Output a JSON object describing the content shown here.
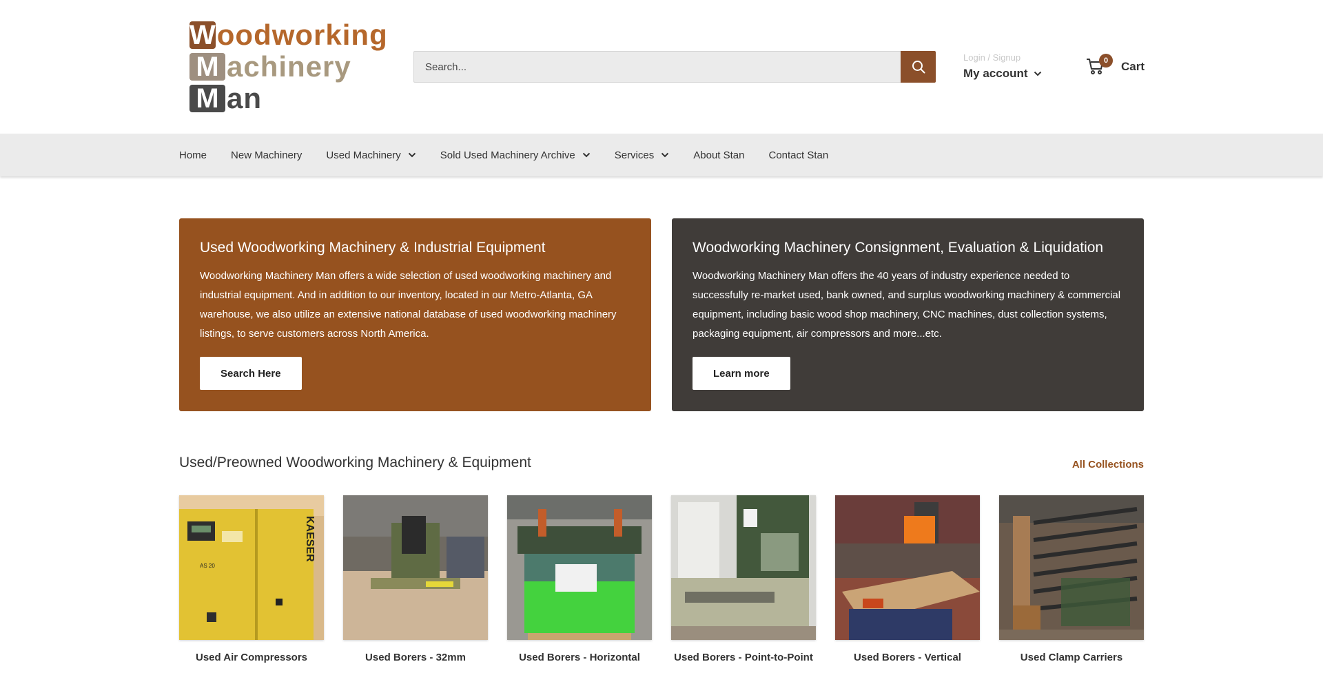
{
  "logo": {
    "rows": [
      {
        "initial": "W",
        "rest": "oodworking"
      },
      {
        "initial": "M",
        "rest": "achinery"
      },
      {
        "initial": "M",
        "rest": "an"
      }
    ]
  },
  "search": {
    "placeholder": "Search..."
  },
  "account": {
    "login_label": "Login / Signup",
    "account_label": "My account"
  },
  "cart": {
    "count": "0",
    "label": "Cart"
  },
  "nav": {
    "items": [
      {
        "label": "Home"
      },
      {
        "label": "New Machinery"
      },
      {
        "label": "Used Machinery"
      },
      {
        "label": "Sold Used Machinery Archive"
      },
      {
        "label": "Services"
      },
      {
        "label": "About Stan"
      },
      {
        "label": "Contact Stan"
      }
    ]
  },
  "promos": [
    {
      "title": "Used Woodworking Machinery & Industrial Equipment",
      "text": "Woodworking Machinery Man offers a wide selection of used woodworking machinery and industrial equipment. And in addition to our inventory, located in our Metro-Atlanta, GA warehouse, we also utilize an extensive national database of used woodworking machinery listings, to serve customers across North America.",
      "button": "Search Here"
    },
    {
      "title": "Woodworking Machinery Consignment, Evaluation & Liquidation",
      "text": "Woodworking Machinery Man offers the 40 years of industry experience needed to successfully re-market used, bank owned, and surplus woodworking machinery & commercial equipment, including basic wood shop machinery, CNC machines, dust collection systems, packaging equipment, air compressors and more...etc.",
      "button": "Learn more"
    }
  ],
  "collections": {
    "title": "Used/Preowned Woodworking Machinery & Equipment",
    "all_link": "All Collections",
    "items": [
      {
        "label": "Used Air Compressors",
        "image_text": "KAESER"
      },
      {
        "label": "Used Borers - 32mm"
      },
      {
        "label": "Used Borers - Horizontal"
      },
      {
        "label": "Used Borers - Point-to-Point"
      },
      {
        "label": "Used Borers - Vertical"
      },
      {
        "label": "Used Clamp Carriers"
      }
    ]
  },
  "colors": {
    "brand_brown": "#96521f",
    "dark": "#403c39",
    "nav_bg": "#ebebeb"
  }
}
